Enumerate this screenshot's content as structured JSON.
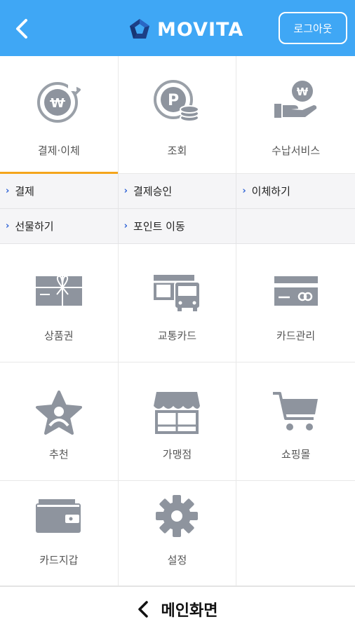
{
  "header": {
    "brand": "MOVITA",
    "logout_label": "로그아웃",
    "bg_color": "#3fa7f5"
  },
  "top_menu": [
    {
      "label": "결제·이체",
      "icon": "won-refresh-icon",
      "active": true
    },
    {
      "label": "조회",
      "icon": "point-coins-icon",
      "active": false
    },
    {
      "label": "수납서비스",
      "icon": "hand-won-icon",
      "active": false
    }
  ],
  "submenu": [
    {
      "label": "결제"
    },
    {
      "label": "결제승인"
    },
    {
      "label": "이체하기"
    },
    {
      "label": "선물하기"
    },
    {
      "label": "포인트 이동"
    }
  ],
  "grid_items": [
    {
      "label": "상품권",
      "icon": "gift-voucher-icon"
    },
    {
      "label": "교통카드",
      "icon": "bus-card-icon"
    },
    {
      "label": "카드관리",
      "icon": "credit-card-icon"
    },
    {
      "label": "추천",
      "icon": "star-person-icon"
    },
    {
      "label": "가맹점",
      "icon": "store-icon"
    },
    {
      "label": "쇼핑몰",
      "icon": "shopping-cart-icon"
    },
    {
      "label": "카드지갑",
      "icon": "wallet-icon"
    },
    {
      "label": "설정",
      "icon": "gear-icon"
    }
  ],
  "bottom_bar": {
    "label": "메인화면"
  },
  "colors": {
    "accent": "#f4a51c",
    "icon_gray": "#8e949e",
    "chevron_blue": "#2f63d6"
  }
}
